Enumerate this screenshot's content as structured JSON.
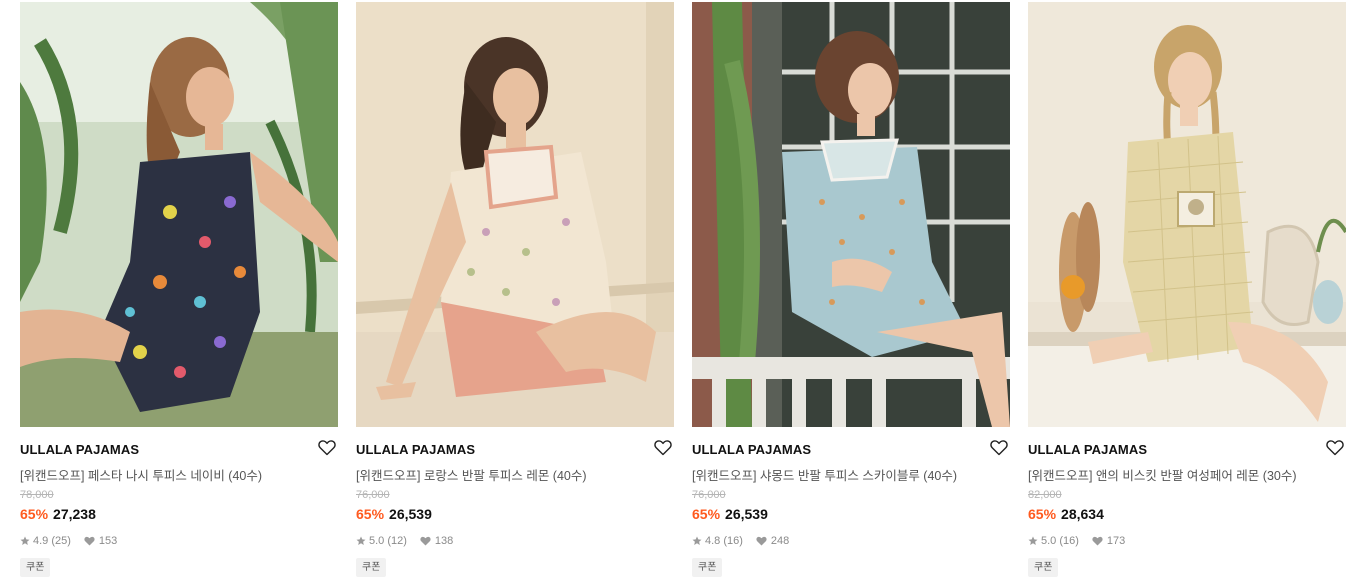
{
  "products": [
    {
      "brand": "ULLALA PAJAMAS",
      "title": "[위캔드오프] 페스타 나시 투피스 네이비 (40수)",
      "original_price": "78,000",
      "discount": "65%",
      "price": "27,238",
      "rating": "4.9 (25)",
      "likes": "153",
      "badge": "쿠폰"
    },
    {
      "brand": "ULLALA PAJAMAS",
      "title": "[위캔드오프] 로랑스 반팔 투피스 레몬 (40수)",
      "original_price": "76,000",
      "discount": "65%",
      "price": "26,539",
      "rating": "5.0 (12)",
      "likes": "138",
      "badge": "쿠폰"
    },
    {
      "brand": "ULLALA PAJAMAS",
      "title": "[위캔드오프] 샤몽드 반팔 투피스 스카이블루 (40수)",
      "original_price": "76,000",
      "discount": "65%",
      "price": "26,539",
      "rating": "4.8 (16)",
      "likes": "248",
      "badge": "쿠폰"
    },
    {
      "brand": "ULLALA PAJAMAS",
      "title": "[위캔드오프] 앤의 비스킷 반팔 여성페어 레몬 (30수)",
      "original_price": "82,000",
      "discount": "65%",
      "price": "28,634",
      "rating": "5.0 (16)",
      "likes": "173",
      "badge": "쿠폰"
    }
  ],
  "icons": {
    "wishlist": "heart-outline-icon",
    "rating": "star-icon",
    "likes": "heart-filled-icon"
  },
  "colors": {
    "discount": "#ff5a1f",
    "brand_text": "#111111",
    "title_text": "#555555",
    "strike_price": "#b5b5b5",
    "meta_text": "#8a8a8a",
    "badge_bg": "#f1f1f1"
  }
}
